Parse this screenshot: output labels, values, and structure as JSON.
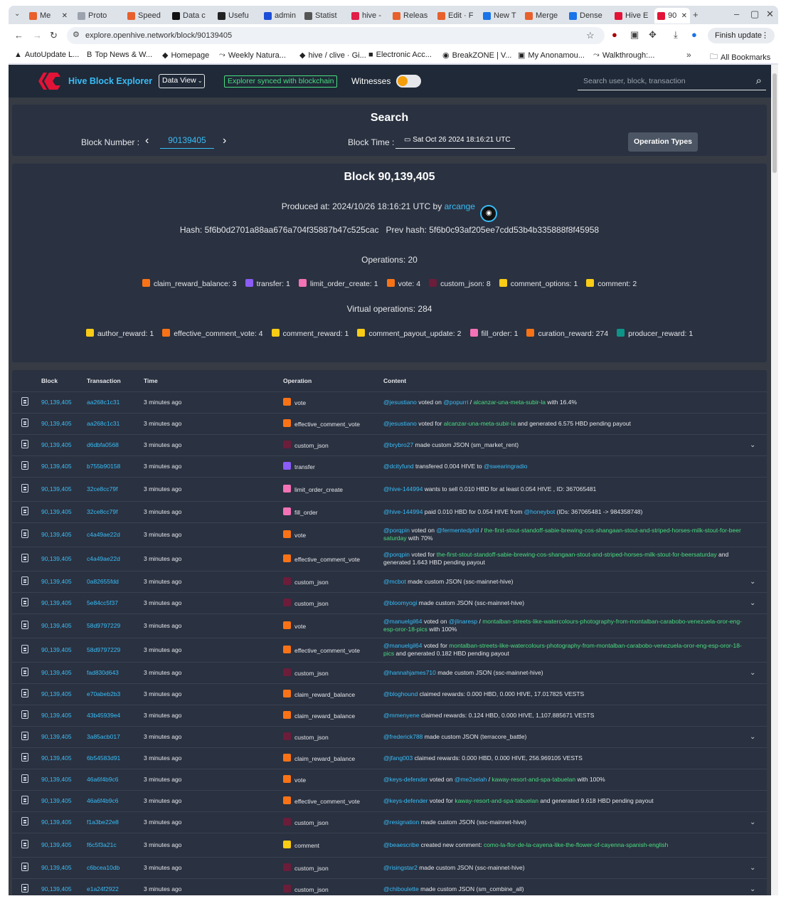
{
  "browser": {
    "tabs": [
      "Me",
      "Proto",
      "Speed",
      "Data c",
      "Usefu",
      "admin",
      "Statist",
      "hive -",
      "Releas",
      "Edit · F",
      "New T",
      "Merge",
      "Dense",
      "Hive E",
      "90"
    ],
    "tab_colors": [
      "#e8602c",
      "#9ca3af",
      "#e8602c",
      "#111",
      "#222",
      "#1d4ed8",
      "#555",
      "#e11d48",
      "#e8602c",
      "#e8602c",
      "#1a73e8",
      "#e8602c",
      "#1a73e8",
      "#e31337",
      "#e31337"
    ],
    "url": "explore.openhive.network/block/90139405",
    "finish_update": "Finish update",
    "bookmarks": [
      "AutoUpdate L...",
      "Top News & W...",
      "Homepage",
      "Weekly Natura...",
      "hive / clive · Gi...",
      "Electronic Acc...",
      "BreakZONE | V...",
      "My Anonamou...",
      "Walkthrough:..."
    ],
    "all_bookmarks": "All Bookmarks"
  },
  "header": {
    "title": "Hive Block Explorer",
    "data_view": "Data View",
    "sync_status": "Explorer synced with blockchain",
    "witnesses": "Witnesses",
    "search_placeholder": "Search user, block, transaction"
  },
  "search": {
    "title": "Search",
    "block_number_label": "Block Number :",
    "block_number": "90139405",
    "block_time_label": "Block Time :",
    "block_time": "Sat Oct 26 2024 18:16:21 UTC",
    "operation_types": "Operation Types"
  },
  "block": {
    "title": "Block 90,139,405",
    "produced_prefix": "Produced at: 2024/10/26 18:16:21 UTC by",
    "producer": "arcange",
    "hash": "Hash: 5f6b0d2701a88aa676a704f35887b47c525cac",
    "prev_hash": "Prev hash: 5f6b0c93af205ee7cdd53b4b335888f8f45958",
    "operations_label": "Operations: 20",
    "operations": [
      {
        "name": "claim_reward_balance:",
        "count": "3",
        "color": "#f97316"
      },
      {
        "name": "transfer:",
        "count": "1",
        "color": "#8b5cf6"
      },
      {
        "name": "limit_order_create:",
        "count": "1",
        "color": "#f472b6"
      },
      {
        "name": "vote:",
        "count": "4",
        "color": "#f97316"
      },
      {
        "name": "custom_json:",
        "count": "8",
        "color": "#6b1d3a"
      },
      {
        "name": "comment_options:",
        "count": "1",
        "color": "#facc15"
      },
      {
        "name": "comment:",
        "count": "2",
        "color": "#facc15"
      }
    ],
    "virtual_label": "Virtual operations: 284",
    "virtual_operations": [
      {
        "name": "author_reward:",
        "count": "1",
        "color": "#facc15"
      },
      {
        "name": "effective_comment_vote:",
        "count": "4",
        "color": "#f97316"
      },
      {
        "name": "comment_reward:",
        "count": "1",
        "color": "#facc15"
      },
      {
        "name": "comment_payout_update:",
        "count": "2",
        "color": "#facc15"
      },
      {
        "name": "fill_order:",
        "count": "1",
        "color": "#f472b6"
      },
      {
        "name": "curation_reward:",
        "count": "274",
        "color": "#f97316"
      },
      {
        "name": "producer_reward:",
        "count": "1",
        "color": "#0d9488"
      }
    ]
  },
  "table": {
    "headers": [
      "Block",
      "Transaction",
      "Time",
      "Operation",
      "Content"
    ],
    "rows": [
      {
        "block": "90,139,405",
        "trx": "aa268c1c31",
        "time": "3 minutes ago",
        "op": "vote",
        "color": "#f97316",
        "parts": [
          [
            "l",
            "@jesustiano"
          ],
          [
            "t",
            " voted on "
          ],
          [
            "l",
            "@popurri"
          ],
          [
            "t",
            " / "
          ],
          [
            "g",
            "alcanzar-una-meta-subir-la"
          ],
          [
            "t",
            " with 16.4%"
          ]
        ],
        "exp": false
      },
      {
        "block": "90,139,405",
        "trx": "aa268c1c31",
        "time": "3 minutes ago",
        "op": "effective_comment_vote",
        "color": "#f97316",
        "parts": [
          [
            "l",
            "@jesustiano"
          ],
          [
            "t",
            " voted for "
          ],
          [
            "g",
            "alcanzar-una-meta-subir-la"
          ],
          [
            "t",
            " and generated 6.575 HBD pending payout"
          ]
        ],
        "exp": false
      },
      {
        "block": "90,139,405",
        "trx": "d6dbfa0568",
        "time": "3 minutes ago",
        "op": "custom_json",
        "color": "#6b1d3a",
        "parts": [
          [
            "l",
            "@brybro27"
          ],
          [
            "t",
            " made custom JSON (sm_market_rent)"
          ]
        ],
        "exp": true
      },
      {
        "block": "90,139,405",
        "trx": "b755b90158",
        "time": "3 minutes ago",
        "op": "transfer",
        "color": "#8b5cf6",
        "parts": [
          [
            "l",
            "@dcityfund"
          ],
          [
            "t",
            " transfered 0.004 HIVE to "
          ],
          [
            "l",
            "@swearingradio"
          ]
        ],
        "exp": false
      },
      {
        "block": "90,139,405",
        "trx": "32ce8cc79f",
        "time": "3 minutes ago",
        "op": "limit_order_create",
        "color": "#f472b6",
        "parts": [
          [
            "l",
            "@hive-144994"
          ],
          [
            "t",
            " wants to sell 0.010 HBD for at least 0.054 HIVE , ID: 367065481"
          ]
        ],
        "exp": false
      },
      {
        "block": "90,139,405",
        "trx": "32ce8cc79f",
        "time": "3 minutes ago",
        "op": "fill_order",
        "color": "#f472b6",
        "parts": [
          [
            "l",
            "@hive-144994"
          ],
          [
            "t",
            " paid 0.010 HBD for 0.054 HIVE from "
          ],
          [
            "l",
            "@honeybot"
          ],
          [
            "t",
            " (IDs: 367065481 -> 984358748)"
          ]
        ],
        "exp": false
      },
      {
        "block": "90,139,405",
        "trx": "c4a49ae22d",
        "time": "3 minutes ago",
        "op": "vote",
        "color": "#f97316",
        "parts": [
          [
            "l",
            "@porqpin"
          ],
          [
            "t",
            " voted on "
          ],
          [
            "l",
            "@fermentedphil"
          ],
          [
            "t",
            " / "
          ],
          [
            "g",
            "the-first-stout-standoff-sabie-brewing-cos-shangaan-stout-and-striped-horses-milk-stout-for-beersaturday"
          ],
          [
            "t",
            " with 70%"
          ]
        ],
        "exp": false
      },
      {
        "block": "90,139,405",
        "trx": "c4a49ae22d",
        "time": "3 minutes ago",
        "op": "effective_comment_vote",
        "color": "#f97316",
        "parts": [
          [
            "l",
            "@porqpin"
          ],
          [
            "t",
            " voted for "
          ],
          [
            "g",
            "the-first-stout-standoff-sabie-brewing-cos-shangaan-stout-and-striped-horses-milk-stout-for-beersaturday"
          ],
          [
            "t",
            " and generated 1.643 HBD pending payout"
          ]
        ],
        "exp": false
      },
      {
        "block": "90,139,405",
        "trx": "0a82655fdd",
        "time": "3 minutes ago",
        "op": "custom_json",
        "color": "#6b1d3a",
        "parts": [
          [
            "l",
            "@mcbot"
          ],
          [
            "t",
            " made custom JSON (ssc-mainnet-hive)"
          ]
        ],
        "exp": true
      },
      {
        "block": "90,139,405",
        "trx": "5e84cc5f37",
        "time": "3 minutes ago",
        "op": "custom_json",
        "color": "#6b1d3a",
        "parts": [
          [
            "l",
            "@bloomyogi"
          ],
          [
            "t",
            " made custom JSON (ssc-mainnet-hive)"
          ]
        ],
        "exp": true
      },
      {
        "block": "90,139,405",
        "trx": "58d9797229",
        "time": "3 minutes ago",
        "op": "vote",
        "color": "#f97316",
        "parts": [
          [
            "l",
            "@manuelgil64"
          ],
          [
            "t",
            " voted on "
          ],
          [
            "l",
            "@jlinaresp"
          ],
          [
            "t",
            " / "
          ],
          [
            "g",
            "montalban-streets-like-watercolours-photography-from-montalban-carabobo-venezuela-oror-eng-esp-oror-18-pics"
          ],
          [
            "t",
            " with 100%"
          ]
        ],
        "exp": false
      },
      {
        "block": "90,139,405",
        "trx": "58d9797229",
        "time": "3 minutes ago",
        "op": "effective_comment_vote",
        "color": "#f97316",
        "parts": [
          [
            "l",
            "@manuelgil64"
          ],
          [
            "t",
            " voted for "
          ],
          [
            "g",
            "montalban-streets-like-watercolours-photography-from-montalban-carabobo-venezuela-oror-eng-esp-oror-18-pics"
          ],
          [
            "t",
            " and generated 0.182 HBD pending payout"
          ]
        ],
        "exp": false
      },
      {
        "block": "90,139,405",
        "trx": "fad830d643",
        "time": "3 minutes ago",
        "op": "custom_json",
        "color": "#6b1d3a",
        "parts": [
          [
            "l",
            "@hannahjames710"
          ],
          [
            "t",
            " made custom JSON (ssc-mainnet-hive)"
          ]
        ],
        "exp": true
      },
      {
        "block": "90,139,405",
        "trx": "e70abeb2b3",
        "time": "3 minutes ago",
        "op": "claim_reward_balance",
        "color": "#f97316",
        "parts": [
          [
            "l",
            "@bloghound"
          ],
          [
            "t",
            " claimed rewards: 0.000 HBD, 0.000 HIVE, 17.017825 VESTS"
          ]
        ],
        "exp": false
      },
      {
        "block": "90,139,405",
        "trx": "43b45939e4",
        "time": "3 minutes ago",
        "op": "claim_reward_balance",
        "color": "#f97316",
        "parts": [
          [
            "l",
            "@mmenyene"
          ],
          [
            "t",
            " claimed rewards: 0.124 HBD, 0.000 HIVE, 1,107.885671 VESTS"
          ]
        ],
        "exp": false
      },
      {
        "block": "90,139,405",
        "trx": "3a85acb017",
        "time": "3 minutes ago",
        "op": "custom_json",
        "color": "#6b1d3a",
        "parts": [
          [
            "l",
            "@frederick788"
          ],
          [
            "t",
            " made custom JSON (terracore_battle)"
          ]
        ],
        "exp": true
      },
      {
        "block": "90,139,405",
        "trx": "6b54583d91",
        "time": "3 minutes ago",
        "op": "claim_reward_balance",
        "color": "#f97316",
        "parts": [
          [
            "l",
            "@jfang003"
          ],
          [
            "t",
            " claimed rewards: 0.000 HBD, 0.000 HIVE, 256.969105 VESTS"
          ]
        ],
        "exp": false
      },
      {
        "block": "90,139,405",
        "trx": "46a6f4b9c6",
        "time": "3 minutes ago",
        "op": "vote",
        "color": "#f97316",
        "parts": [
          [
            "l",
            "@keys-defender"
          ],
          [
            "t",
            " voted on "
          ],
          [
            "l",
            "@me2selah"
          ],
          [
            "t",
            " / "
          ],
          [
            "g",
            "kaway-resort-and-spa-tabuelan"
          ],
          [
            "t",
            " with 100%"
          ]
        ],
        "exp": false
      },
      {
        "block": "90,139,405",
        "trx": "46a6f4b9c6",
        "time": "3 minutes ago",
        "op": "effective_comment_vote",
        "color": "#f97316",
        "parts": [
          [
            "l",
            "@keys-defender"
          ],
          [
            "t",
            " voted for "
          ],
          [
            "g",
            "kaway-resort-and-spa-tabuelan"
          ],
          [
            "t",
            " and generated 9.618 HBD pending payout"
          ]
        ],
        "exp": false
      },
      {
        "block": "90,139,405",
        "trx": "f1a3be22e8",
        "time": "3 minutes ago",
        "op": "custom_json",
        "color": "#6b1d3a",
        "parts": [
          [
            "l",
            "@resignation"
          ],
          [
            "t",
            " made custom JSON (ssc-mainnet-hive)"
          ]
        ],
        "exp": true
      },
      {
        "block": "90,139,405",
        "trx": "f6c5f3a21c",
        "time": "3 minutes ago",
        "op": "comment",
        "color": "#facc15",
        "parts": [
          [
            "l",
            "@beaescribe"
          ],
          [
            "t",
            " created new comment: "
          ],
          [
            "g",
            "como-la-flor-de-la-cayena-like-the-flower-of-cayenna-spanish-english"
          ]
        ],
        "exp": false
      },
      {
        "block": "90,139,405",
        "trx": "c6bcea10db",
        "time": "3 minutes ago",
        "op": "custom_json",
        "color": "#6b1d3a",
        "parts": [
          [
            "l",
            "@risingstar2"
          ],
          [
            "t",
            " made custom JSON (ssc-mainnet-hive)"
          ]
        ],
        "exp": true
      },
      {
        "block": "90,139,405",
        "trx": "e1a24f2922",
        "time": "3 minutes ago",
        "op": "custom_json",
        "color": "#6b1d3a",
        "parts": [
          [
            "l",
            "@chiboulette"
          ],
          [
            "t",
            " made custom JSON (sm_combine_all)"
          ]
        ],
        "exp": true
      }
    ]
  }
}
